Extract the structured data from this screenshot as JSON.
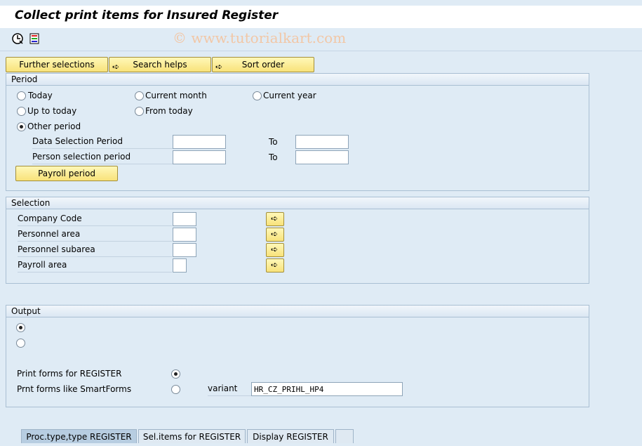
{
  "window": {
    "title": "Collect print items for Insured Register"
  },
  "toolbar": {
    "watermark": "© www.tutorialkart.com",
    "execute_icon": "clock-execute-icon",
    "variant_icon": "get-variant-icon"
  },
  "buttons": {
    "further_selections": "Further selections",
    "search_helps": "Search helps",
    "sort_order": "Sort order"
  },
  "period": {
    "title": "Period",
    "today": "Today",
    "current_month": "Current month",
    "current_year": "Current year",
    "up_to_today": "Up to today",
    "from_today": "From today",
    "other_period": "Other period",
    "data_selection_period": "Data Selection Period",
    "person_selection_period": "Person selection period",
    "to": "To",
    "payroll_period": "Payroll period",
    "selected": "other_period",
    "data_from": "",
    "data_to": "",
    "person_from": "",
    "person_to": ""
  },
  "selection": {
    "title": "Selection",
    "company_code": "Company Code",
    "personnel_area": "Personnel area",
    "personnel_subarea": "Personnel subarea",
    "payroll_area": "Payroll area",
    "company_code_value": "",
    "personnel_area_value": "",
    "personnel_subarea_value": "",
    "payroll_area_value": ""
  },
  "output": {
    "title": "Output",
    "print_forms": "Print forms for REGISTER",
    "smartforms": "Prnt forms like SmartForms",
    "variant_label": "variant",
    "variant_value": "HR_CZ_PRIHL_HP4"
  },
  "tabs": [
    {
      "label": "Proc.type,type REGISTER",
      "active": true
    },
    {
      "label": "Sel.items for REGISTER",
      "active": false
    },
    {
      "label": "Display REGISTER",
      "active": false
    }
  ],
  "colors": {
    "background": "#dfebf5",
    "button": "#f8e27a",
    "tab_active": "#b7cde1"
  }
}
